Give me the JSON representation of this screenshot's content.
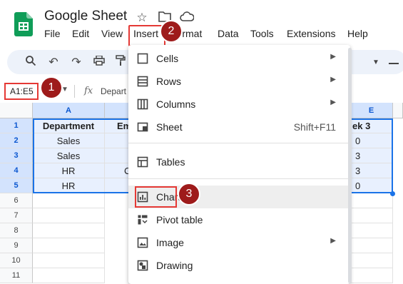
{
  "app": {
    "title": "Google Sheet"
  },
  "menubar": [
    "File",
    "Edit",
    "View",
    "Insert",
    "Format",
    "Data",
    "Tools",
    "Extensions",
    "Help"
  ],
  "namebox": {
    "value": "A1:E5"
  },
  "formula": {
    "text": "Depart"
  },
  "columns": [
    "A",
    "",
    "",
    "",
    "E"
  ],
  "rows": [
    "1",
    "2",
    "3",
    "4",
    "5",
    "6",
    "7",
    "8",
    "9",
    "10",
    "11"
  ],
  "grid": [
    [
      "Department",
      "Em",
      "ek 3"
    ],
    [
      "Sales",
      "",
      "0"
    ],
    [
      "Sales",
      "",
      "3"
    ],
    [
      "HR",
      "C",
      "3"
    ],
    [
      "HR",
      "",
      "0"
    ]
  ],
  "insert_menu": {
    "items": [
      {
        "label": "Cells",
        "icon": "cell-icon",
        "submenu": true
      },
      {
        "label": "Rows",
        "icon": "rows-icon",
        "submenu": true
      },
      {
        "label": "Columns",
        "icon": "columns-icon",
        "submenu": true
      },
      {
        "label": "Sheet",
        "icon": "sheet-icon",
        "shortcut": "Shift+F11"
      },
      {
        "label": "Tables",
        "icon": "table-icon"
      },
      {
        "label": "Chart",
        "icon": "chart-icon"
      },
      {
        "label": "Pivot table",
        "icon": "pivot-table-icon"
      },
      {
        "label": "Image",
        "icon": "image-icon",
        "submenu": true
      },
      {
        "label": "Drawing",
        "icon": "drawing-icon"
      }
    ]
  },
  "badges": {
    "one": "1",
    "two": "2",
    "three": "3"
  },
  "colors": {
    "accent": "#1a73e8",
    "badge": "#9e1b1b",
    "highlight": "#e53935",
    "sheets_green": "#0f9d58"
  }
}
